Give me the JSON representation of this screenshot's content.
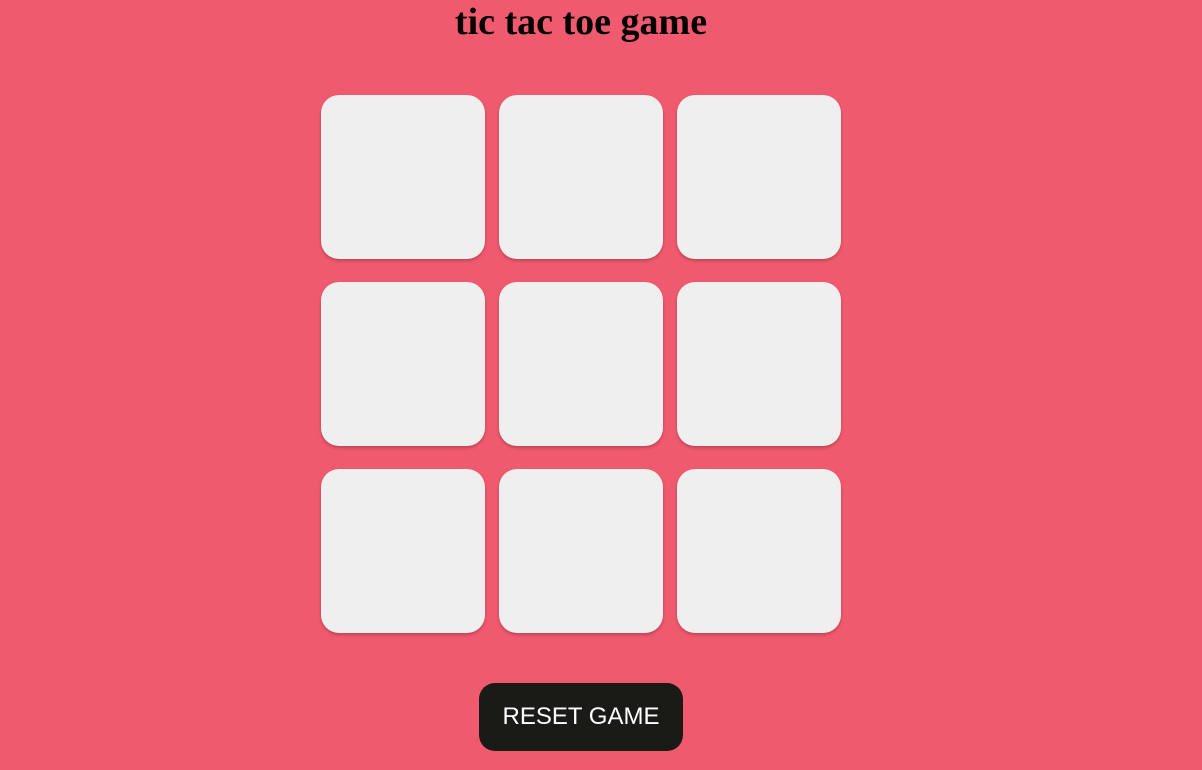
{
  "page": {
    "title": "tic tac toe game"
  },
  "board": {
    "cells": [
      "",
      "",
      "",
      "",
      "",
      "",
      "",
      "",
      ""
    ]
  },
  "controls": {
    "reset_label": "RESET GAME"
  },
  "colors": {
    "background": "#f05a6e",
    "cell": "#f0efef",
    "button": "#1a1a16",
    "button_text": "#ffffff"
  }
}
